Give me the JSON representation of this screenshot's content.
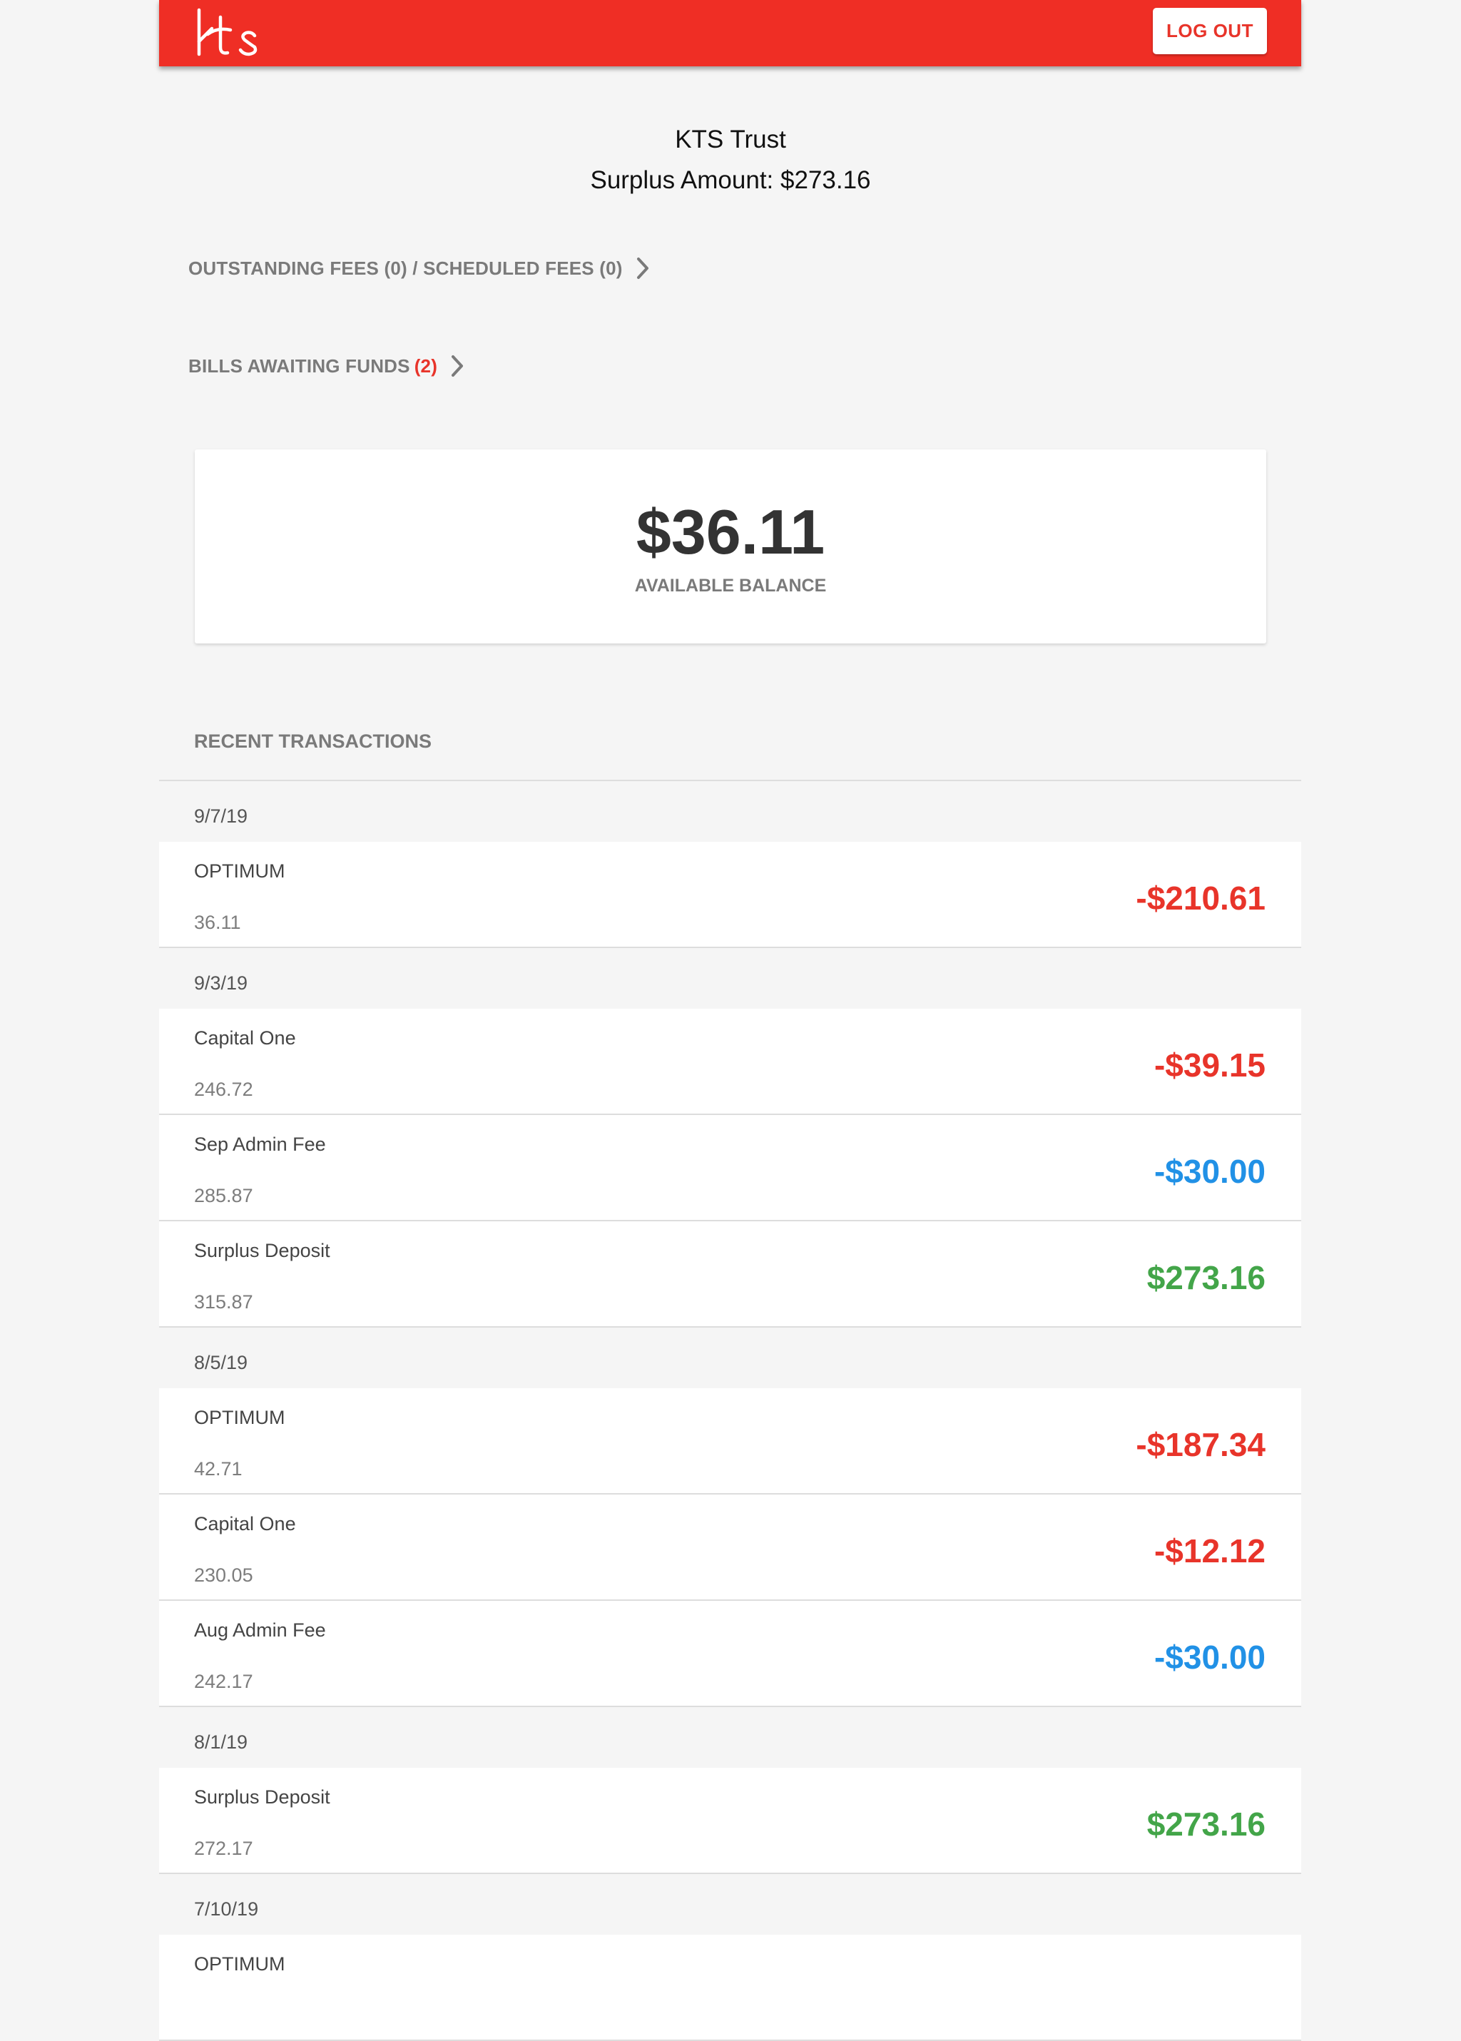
{
  "header": {
    "logo_text": "kts",
    "logout_label": "LOG OUT"
  },
  "account": {
    "name": "KTS Trust",
    "surplus": "Surplus Amount: $273.16"
  },
  "nav": {
    "fees_label": "OUTSTANDING FEES (0) / SCHEDULED FEES (0)",
    "bills_label": "BILLS AWAITING FUNDS",
    "bills_count": "(2)"
  },
  "balance": {
    "amount": "$36.11",
    "label": "AVAILABLE BALANCE"
  },
  "transactions": {
    "title": "RECENT TRANSACTIONS",
    "groups": [
      {
        "date": "9/7/19",
        "items": [
          {
            "name": "OPTIMUM",
            "balance": "36.11",
            "amount": "-$210.61",
            "kind": "neg"
          }
        ]
      },
      {
        "date": "9/3/19",
        "items": [
          {
            "name": "Capital One",
            "balance": "246.72",
            "amount": "-$39.15",
            "kind": "neg"
          },
          {
            "name": "Sep Admin Fee",
            "balance": "285.87",
            "amount": "-$30.00",
            "kind": "fee"
          },
          {
            "name": "Surplus Deposit",
            "balance": "315.87",
            "amount": "$273.16",
            "kind": "pos"
          }
        ]
      },
      {
        "date": "8/5/19",
        "items": [
          {
            "name": "OPTIMUM",
            "balance": "42.71",
            "amount": "-$187.34",
            "kind": "neg"
          },
          {
            "name": "Capital One",
            "balance": "230.05",
            "amount": "-$12.12",
            "kind": "neg"
          },
          {
            "name": "Aug Admin Fee",
            "balance": "242.17",
            "amount": "-$30.00",
            "kind": "fee"
          }
        ]
      },
      {
        "date": "8/1/19",
        "items": [
          {
            "name": "Surplus Deposit",
            "balance": "272.17",
            "amount": "$273.16",
            "kind": "pos"
          }
        ]
      },
      {
        "date": "7/10/19",
        "items": [
          {
            "name": "OPTIMUM",
            "balance": "",
            "amount": "",
            "kind": "neg"
          }
        ]
      }
    ]
  },
  "colors": {
    "brand_red": "#ef2e25",
    "negative": "#e8342a",
    "fee": "#2191e6",
    "positive": "#43a549"
  }
}
